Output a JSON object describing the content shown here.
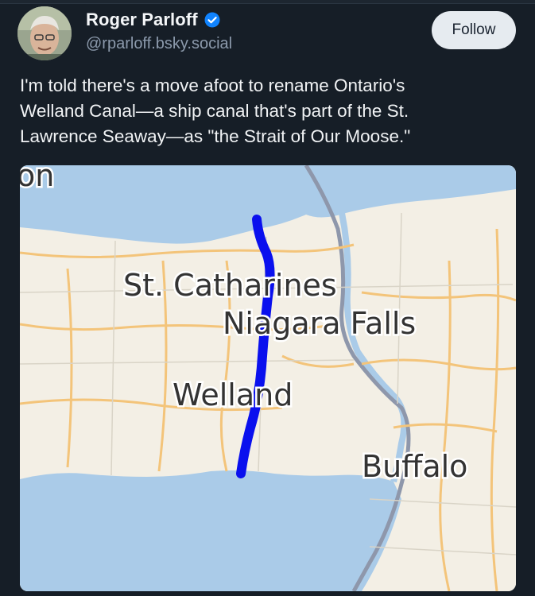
{
  "author": {
    "name": "Roger Parloff",
    "handle": "@rparloff.bsky.social",
    "verified_icon": "verified-badge-icon",
    "avatar": "avatar-photo"
  },
  "actions": {
    "follow_label": "Follow"
  },
  "post": {
    "lines": [
      "I'm told there's a move afoot to rename Ontario's",
      "Welland Canal—a ship canal that's part of the St.",
      "Lawrence Seaway—as \"the Strait of Our Moose.\""
    ]
  },
  "map": {
    "labels": {
      "corner": "on",
      "st_catharines": "St. Catharines",
      "niagara_falls": "Niagara Falls",
      "welland": "Welland",
      "buffalo": "Buffalo"
    },
    "colors": {
      "water": "#aacbe8",
      "land": "#f3efe5",
      "canal_line": "#0a10ee",
      "border": "#8e97ab",
      "roads": "#f3c47a"
    }
  },
  "colors": {
    "background": "#161e27",
    "accent": "#1083fe",
    "follow_bg": "#e6ebf0"
  }
}
